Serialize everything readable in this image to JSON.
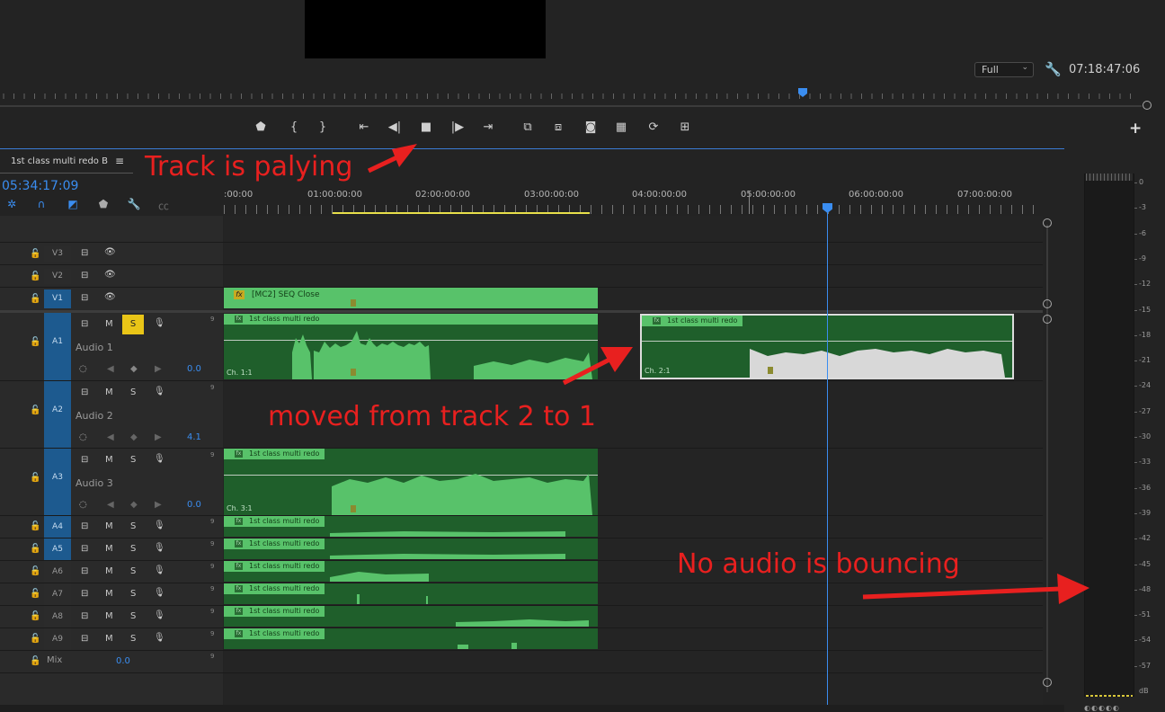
{
  "monitor": {
    "zoom_value": "Full",
    "timecode": "07:18:47:06",
    "transport_icons": [
      "marker-icon",
      "in-point-icon",
      "out-point-icon",
      "go-to-in-icon",
      "step-back-icon",
      "stop-icon",
      "step-forward-icon",
      "go-to-out-icon",
      "insert-icon",
      "overwrite-icon",
      "camera-icon",
      "multicam-icon",
      "loop-icon",
      "safe-margins-icon"
    ]
  },
  "sequence": {
    "name": "1st class multi redo B",
    "menu_glyph": "≡",
    "timecode": "05:34:17:09",
    "ruler_labels": [
      ":00:00",
      "01:00:00:00",
      "02:00:00:00",
      "03:00:00:00",
      "04:00:00:00",
      "05:00:00:00",
      "06:00:00:00",
      "07:00:00:00"
    ]
  },
  "tracks": {
    "video": [
      {
        "id": "V3"
      },
      {
        "id": "V2"
      },
      {
        "id": "V1"
      }
    ],
    "audio": [
      {
        "id": "A1",
        "name": "Audio 1",
        "value": "0.0",
        "nine": "9"
      },
      {
        "id": "A2",
        "name": "Audio 2",
        "value": "4.1",
        "nine": "9"
      },
      {
        "id": "A3",
        "name": "Audio 3",
        "value": "0.0",
        "nine": "9"
      },
      {
        "id": "A4",
        "nine": "9"
      },
      {
        "id": "A5",
        "nine": "9"
      },
      {
        "id": "A6",
        "nine": "9"
      },
      {
        "id": "A7",
        "nine": "9"
      },
      {
        "id": "A8",
        "nine": "9"
      },
      {
        "id": "A9",
        "nine": "9"
      }
    ],
    "mix": {
      "label": "Mix",
      "value": "0.0",
      "nine": "9"
    },
    "m_label": "M",
    "s_label": "S",
    "fx_label": "fx"
  },
  "clips": {
    "video_clip": "[MC2] SEQ Close",
    "audio_clip": "1st class multi redo",
    "ch_a1": "Ch. 1:1",
    "ch_a1b": "Ch. 2:1",
    "ch_a3": "Ch. 3:1"
  },
  "meter": {
    "db_scale": [
      "0",
      "-3",
      "-6",
      "-9",
      "-12",
      "-15",
      "-18",
      "-21",
      "-24",
      "-27",
      "-30",
      "-33",
      "-36",
      "-39",
      "-42",
      "-45",
      "-48",
      "-51",
      "-54",
      "-57",
      "dB"
    ]
  },
  "annotations": {
    "playing": "Track is palying",
    "moved": "moved from track 2 to 1",
    "no_audio": "No audio is bouncing"
  },
  "colors": {
    "accent_blue": "#3a8df0",
    "clip_green": "#58c26a",
    "clip_dark_green": "#1f5f2b",
    "annotation_red": "#e8201f",
    "solo_yellow": "#e9c517"
  }
}
